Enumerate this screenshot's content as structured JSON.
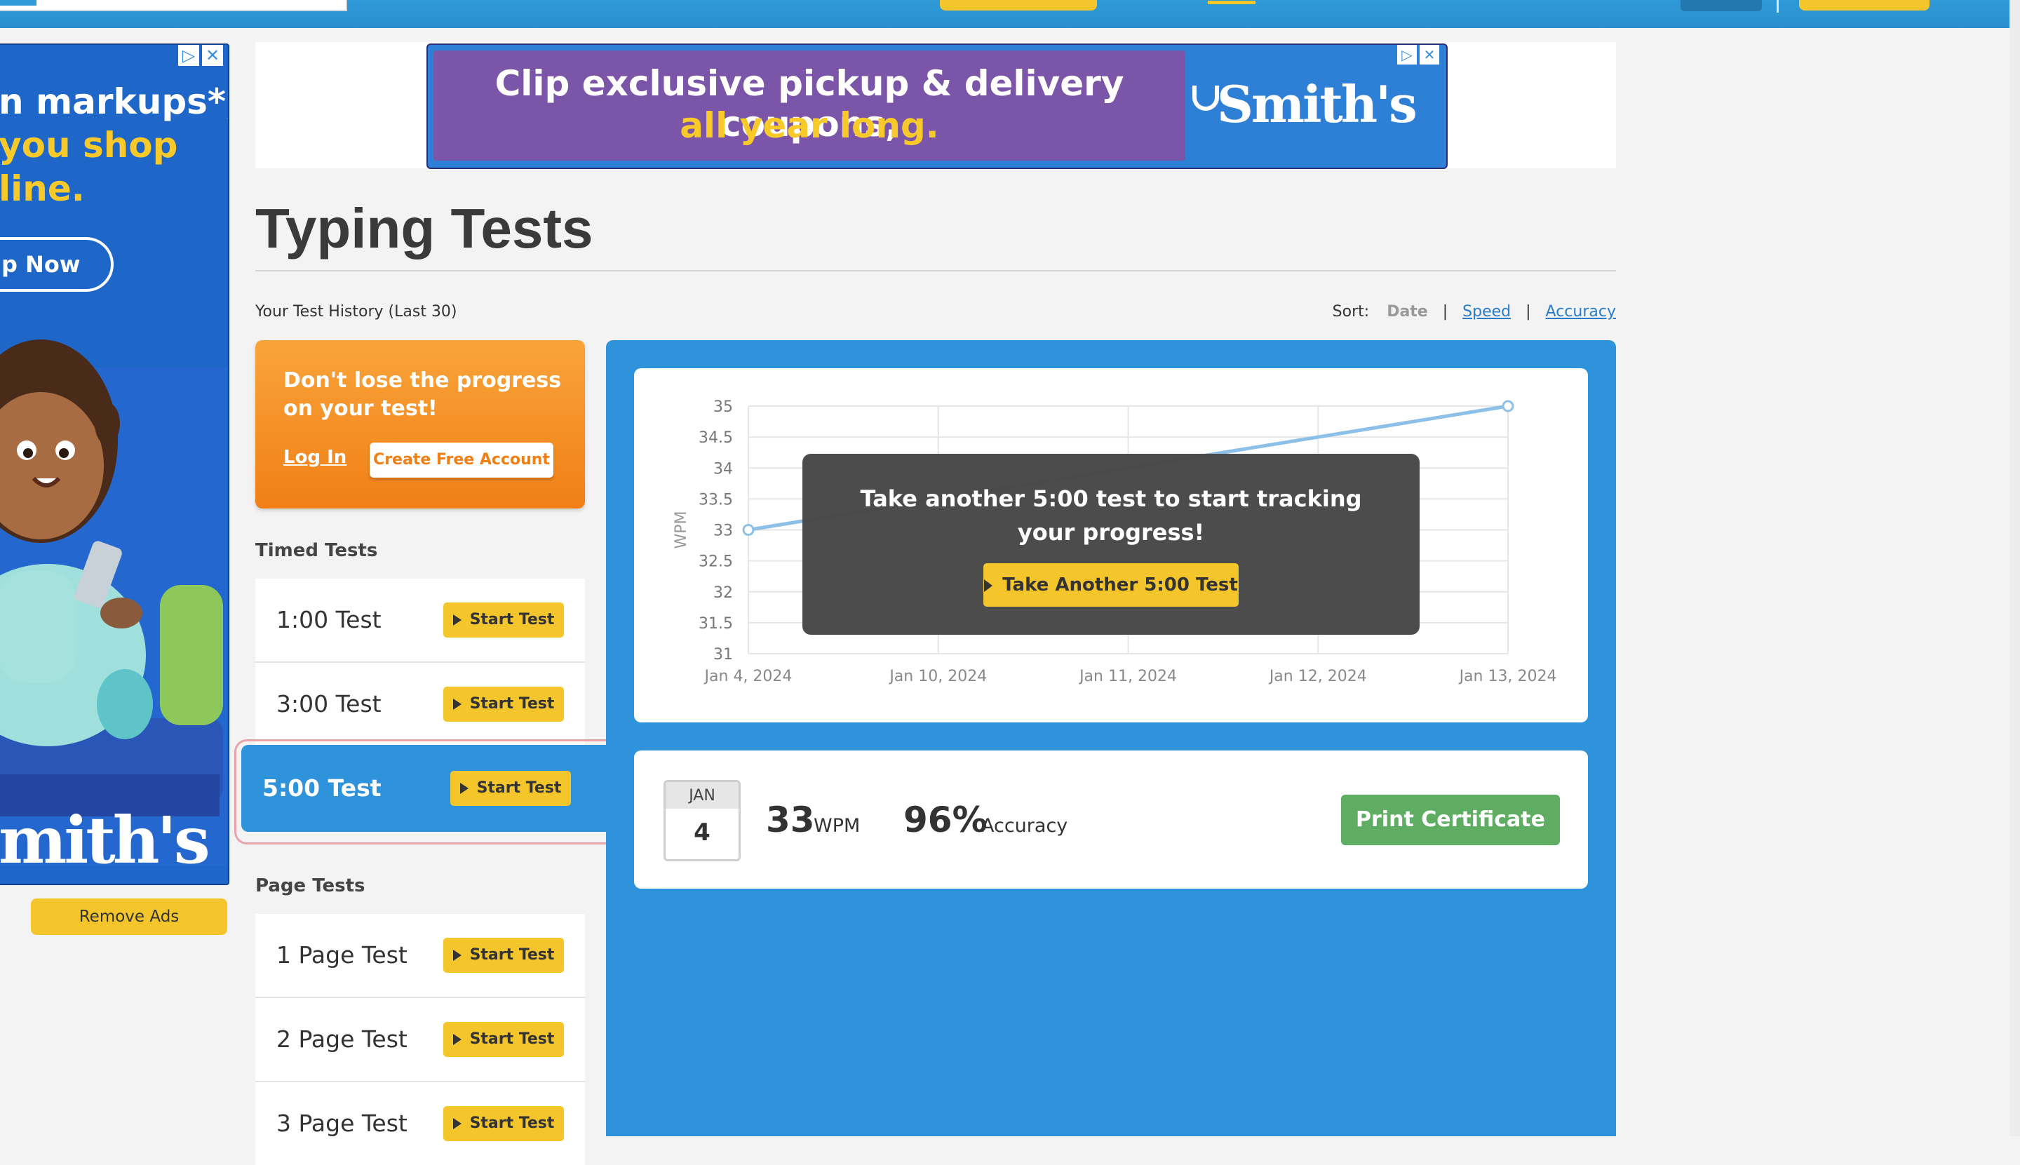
{
  "banner_ad": {
    "line1": "Clip exclusive pickup & delivery coupons,",
    "line2": "all year long.",
    "brand": "Smith's"
  },
  "side_ad": {
    "line1": "n markups*,",
    "line2": "you shop",
    "line3": "line.",
    "button": "p Now",
    "brand": "mith's"
  },
  "remove_ads_label": "Remove Ads",
  "page_title": "Typing Tests",
  "history_label": "Your Test History (Last 30)",
  "sort": {
    "label": "Sort:",
    "date": "Date",
    "speed": "Speed",
    "accuracy": "Accuracy",
    "sep": "|"
  },
  "promo": {
    "message": "Don't lose the progress on your test!",
    "login": "Log In",
    "create": "Create Free Account"
  },
  "timed_label": "Timed Tests",
  "page_label": "Page Tests",
  "start_label": "Start Test",
  "timed_tests": [
    {
      "name": "1:00 Test"
    },
    {
      "name": "3:00 Test"
    },
    {
      "name": "5:00 Test",
      "active": true
    }
  ],
  "page_tests": [
    {
      "name": "1 Page Test"
    },
    {
      "name": "2 Page Test"
    },
    {
      "name": "3 Page Test"
    }
  ],
  "overlay": {
    "message": "Take another 5:00 test to start tracking your progress!",
    "button": "Take Another 5:00 Test"
  },
  "result": {
    "month": "JAN",
    "day": "4",
    "wpm": "33",
    "wpm_unit": "WPM",
    "accuracy": "96%",
    "accuracy_unit": "Accuracy",
    "print": "Print Certificate"
  },
  "chart_data": {
    "type": "line",
    "ylabel": "WPM",
    "xlabel": "",
    "x": [
      "Jan 4, 2024",
      "Jan 10, 2024",
      "Jan 11, 2024",
      "Jan 12, 2024",
      "Jan 13, 2024"
    ],
    "yticks": [
      "35",
      "34.5",
      "34",
      "33.5",
      "33",
      "32.5",
      "32",
      "31.5",
      "31"
    ],
    "ylim": [
      31,
      35
    ],
    "series": [
      {
        "points": [
          {
            "x": "Jan 4, 2024",
            "y": 33
          },
          {
            "x": "Jan 13, 2024",
            "y": 35
          }
        ]
      }
    ],
    "grid": true,
    "line_color": "#8dc0e8"
  },
  "colors": {
    "accent_blue": "#2f93dc",
    "button_yellow": "#f5c62b",
    "promo_orange": "#f07f16",
    "print_green": "#5fad62"
  }
}
